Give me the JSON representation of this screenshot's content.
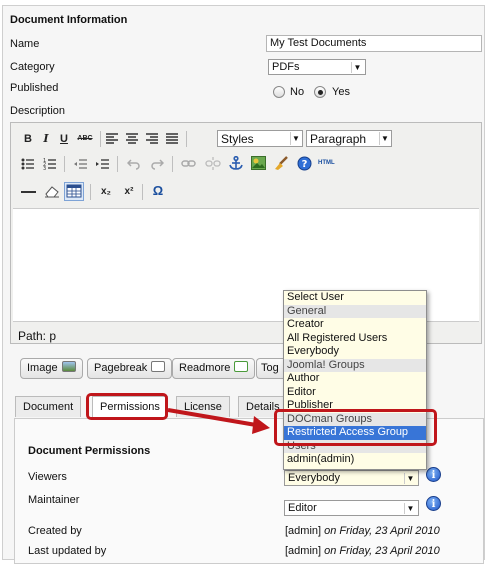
{
  "doc_info": {
    "title": "Document Information",
    "name_label": "Name",
    "name_value": "My Test Documents",
    "category_label": "Category",
    "category_value": "PDFs",
    "published_label": "Published",
    "no_label": "No",
    "yes_label": "Yes",
    "description_label": "Description"
  },
  "editor": {
    "bold": "B",
    "italic": "I",
    "underline": "U",
    "strike": "ABC",
    "styles_select": "Styles",
    "format_select": "Paragraph",
    "html_label": "HTML",
    "subscript": "x₂",
    "superscript": "x²",
    "omega": "Ω",
    "path_text": "Path: p"
  },
  "editor_buttons": [
    "Image",
    "Pagebreak",
    "Readmore",
    "Tog"
  ],
  "tabs": [
    "Document",
    "Permissions",
    "License",
    "Details"
  ],
  "permissions": {
    "title": "Document Permissions",
    "viewers_label": "Viewers",
    "viewers_value": "Everybody",
    "maintainer_label": "Maintainer",
    "maintainer_value": "Editor",
    "created_label": "Created by",
    "created_user": "[admin]",
    "created_date": " on Friday, 23 April 2010",
    "updated_label": "Last updated by",
    "updated_user": "[admin]",
    "updated_date": " on Friday, 23 April 2010",
    "info_glyph": "i"
  },
  "dropdown": {
    "items": [
      {
        "label": "Select User",
        "kind": "item"
      },
      {
        "label": "General",
        "kind": "group"
      },
      {
        "label": "Creator",
        "kind": "item"
      },
      {
        "label": "All Registered Users",
        "kind": "item"
      },
      {
        "label": "Everybody",
        "kind": "item"
      },
      {
        "label": "Joomla! Groups",
        "kind": "group"
      },
      {
        "label": "Author",
        "kind": "item"
      },
      {
        "label": "Editor",
        "kind": "item"
      },
      {
        "label": "Publisher",
        "kind": "item"
      },
      {
        "label": "DOCman Groups",
        "kind": "group"
      },
      {
        "label": "Restricted Access Group",
        "kind": "selected"
      },
      {
        "label": "Users",
        "kind": "group"
      },
      {
        "label": "admin(admin)",
        "kind": "item"
      }
    ]
  },
  "colors": {
    "annotation": "#c0161b",
    "selection": "#3875d7",
    "dropdown_bg": "#fffde6"
  }
}
